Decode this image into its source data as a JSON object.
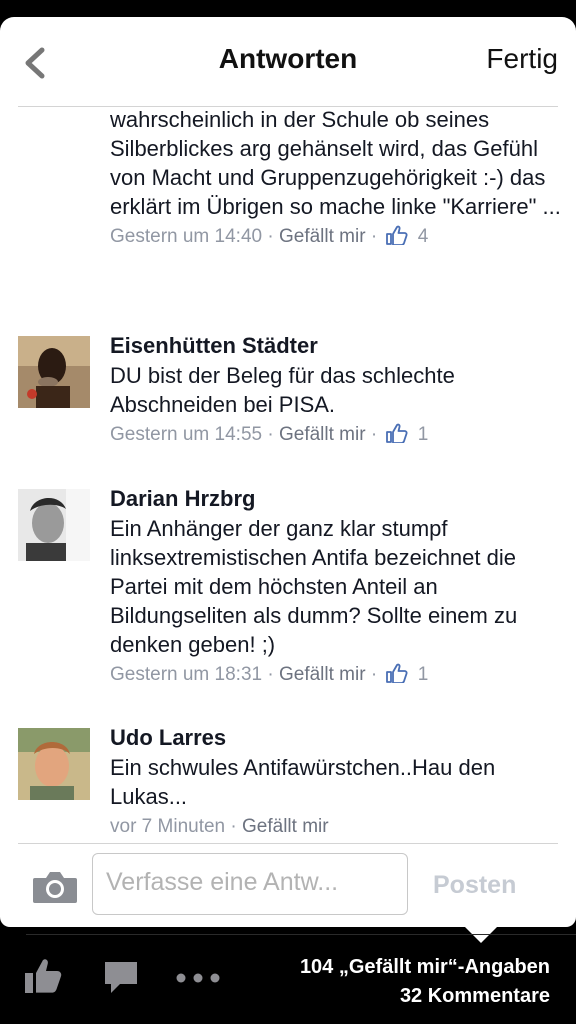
{
  "header": {
    "title": "Antworten",
    "done_label": "Fertig"
  },
  "comments": [
    {
      "author": "",
      "text": "wahrscheinlich in der Schule ob seines Silberblickes arg gehänselt wird, das Gefühl von Macht und Gruppenzugehörigkeit :-)   das erklärt im Übrigen so mache linke \"Karriere\" ...",
      "time": "Gestern um 14:40",
      "like_label": "Gefällt mir",
      "likes": "4"
    },
    {
      "author": "Eisenhütten Städter",
      "text": "DU bist der Beleg für das schlechte Abschneiden bei PISA.",
      "time": "Gestern um 14:55",
      "like_label": "Gefällt mir",
      "likes": "1"
    },
    {
      "author": "Darian Hrzbrg",
      "text": "Ein Anhänger der ganz klar stumpf linksextremistischen Antifa bezeichnet die Partei mit dem höchsten Anteil an Bildungseliten als dumm? Sollte einem zu denken geben! ;)",
      "time": "Gestern um 18:31",
      "like_label": "Gefällt mir",
      "likes": "1"
    },
    {
      "author": "Udo Larres",
      "text": "Ein schwules Antifawürstchen..Hau den Lukas...",
      "time": "vor 7 Minuten",
      "like_label": "Gefällt mir",
      "likes": ""
    }
  ],
  "composer": {
    "placeholder": "Verfasse eine Antw...",
    "post_label": "Posten"
  },
  "footer": {
    "likes_text": "104 „Gefällt mir“-Angaben",
    "comments_text": "32 Kommentare"
  },
  "icons": {
    "back": "chevron-left-icon",
    "camera": "camera-icon",
    "like": "thumbs-up-icon",
    "comment": "speech-bubble-icon",
    "more": "more-dots-icon"
  },
  "colors": {
    "accent_blue": "#3b5998",
    "meta_gray": "#9197a3",
    "text_dark": "#141823"
  }
}
